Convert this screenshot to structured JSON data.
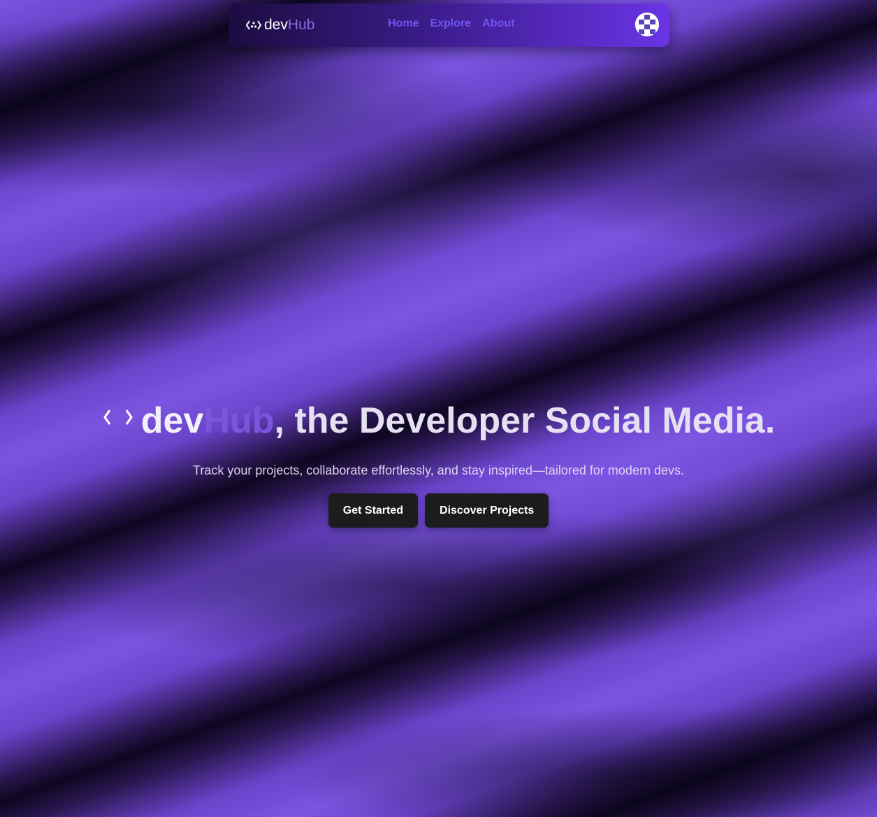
{
  "nav": {
    "brand_dev": "dev",
    "brand_hub": "Hub",
    "links": [
      "Home",
      "Explore",
      "About"
    ],
    "logo_icon": "code-brackets-icon",
    "avatar_icon": "pixel-avatar-icon"
  },
  "hero": {
    "title_dev": "dev",
    "title_hub": "Hub",
    "title_rest": ", the Developer Social Media.",
    "subtitle": "Track your projects, collaborate effortlessly, and stay inspired—tailored for modern devs.",
    "cta_primary": "Get Started",
    "cta_secondary": "Discover Projects"
  },
  "colors": {
    "background": "#6f47cf",
    "accent": "#7b55dc",
    "nav_link": "#6f55f0",
    "button": "#1c1c1c"
  }
}
